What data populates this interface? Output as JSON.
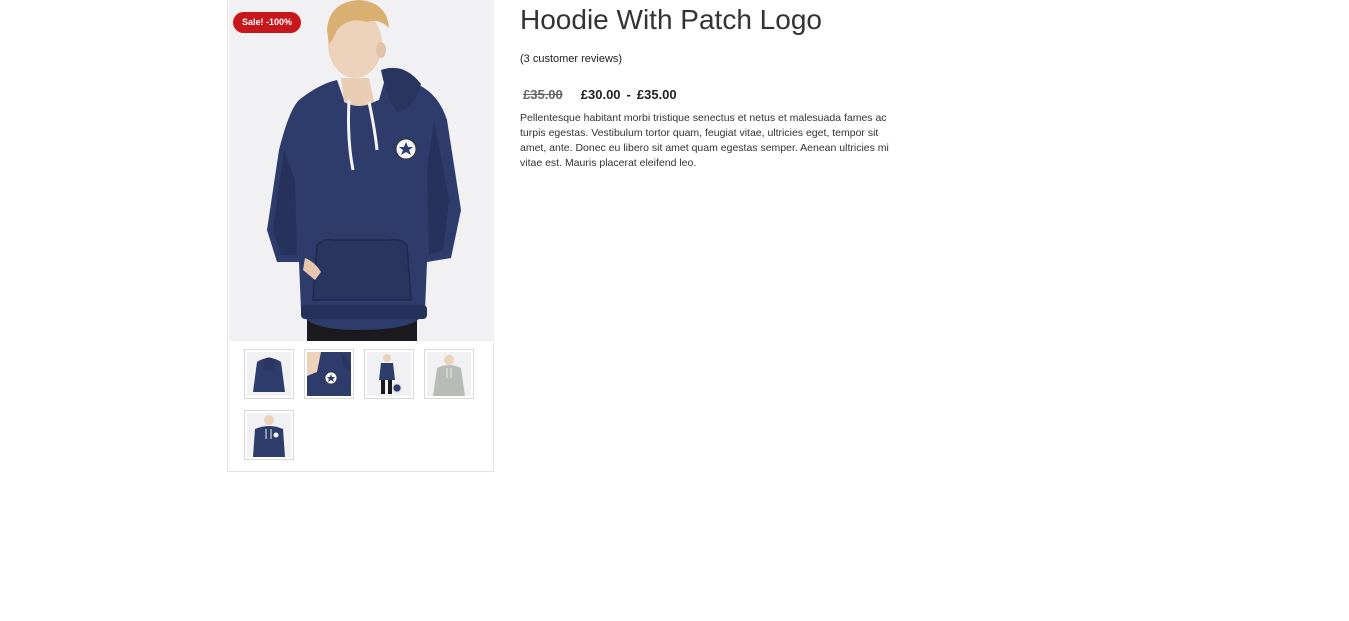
{
  "product": {
    "title": "Hoodie With Patch Logo",
    "reviews_link": "(3 customer reviews)",
    "price": {
      "old": "£35.00",
      "min": "£30.00",
      "separator": "-",
      "max": "£35.00"
    },
    "description": "Pellentesque habitant morbi tristique senectus et netus et malesuada fames ac turpis egestas. Vestibulum tortor quam, feugiat vitae, ultricies eget, tempor sit amet, ante. Donec eu libero sit amet quam egestas semper. Aenean ultricies mi vitae est. Mauris placerat eleifend leo."
  },
  "gallery": {
    "sale_badge": "Sale! -100%",
    "thumbnails": [
      {
        "name": "hoodie-back-thumb",
        "color": "#2a3a6a"
      },
      {
        "name": "hoodie-logo-closeup-thumb",
        "color": "#2a3a6a"
      },
      {
        "name": "hoodie-side-thumb",
        "color": "#2a3a6a"
      },
      {
        "name": "hoodie-grey-thumb",
        "color": "#b8bcb8"
      },
      {
        "name": "hoodie-front-thumb",
        "color": "#2a3a6a"
      }
    ]
  },
  "colors": {
    "sale_badge_bg": "#c8161d",
    "hoodie_navy": "#2a3a6a",
    "image_bg": "#f1f0f2"
  }
}
